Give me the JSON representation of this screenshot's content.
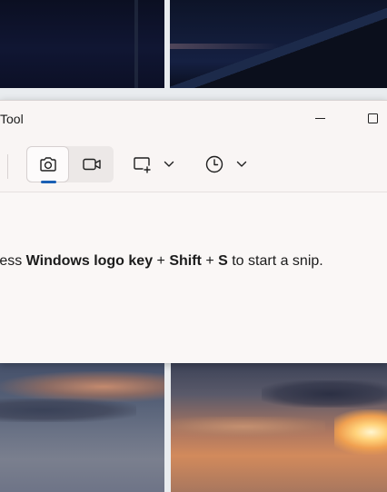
{
  "window": {
    "title": "Tool"
  },
  "titlebar": {
    "minimize_icon": "minimize-icon",
    "maximize_icon": "maximize-icon"
  },
  "toolbar": {
    "modes": [
      {
        "name": "photo",
        "icon": "camera-icon",
        "selected": true
      },
      {
        "name": "video",
        "icon": "video-camera-icon",
        "selected": false
      }
    ],
    "snip_shape_icon": "rectangle-snip-icon",
    "delay_icon": "clock-icon",
    "accent_color": "#1a5fb4"
  },
  "instruction": {
    "part1": "ress ",
    "key1": "Windows logo key",
    "plus1": " + ",
    "key2": "Shift",
    "plus2": " + ",
    "key3": "S",
    "part2": " to start a snip."
  }
}
